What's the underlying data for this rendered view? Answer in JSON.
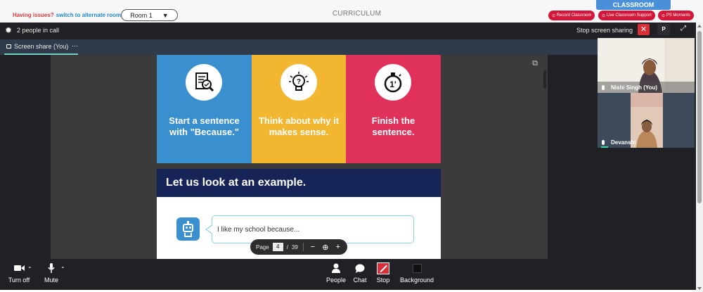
{
  "topbar": {
    "issue_text": "Having issues?",
    "alt_room_link": "switch to alternate room",
    "room_selected": "Room 1",
    "title": "CURRICULUM",
    "classroom_tab": "CLASSROOM",
    "buttons": [
      "Record Classroom",
      "Live Classroom Support",
      "PS Moments"
    ]
  },
  "call": {
    "people_count": "2 people in call",
    "stop_sharing": "Stop screen sharing",
    "p_button": "P",
    "share_label": "Screen share (You)",
    "share_more": "···"
  },
  "slide": {
    "columns": [
      {
        "text": "Start a sentence with \"Because.\"",
        "color": "#3a8fcf"
      },
      {
        "text": "Think about why it makes sense.",
        "color": "#f2b630"
      },
      {
        "text": "Finish the sentence.",
        "color": "#e0315a"
      }
    ],
    "example_title": "Let us look at an example.",
    "bubble_text": "I like my school because..."
  },
  "pager": {
    "label": "Page",
    "current": "4",
    "separator": "/",
    "total": "39"
  },
  "participants": [
    {
      "name": "Nishi Singh (You)"
    },
    {
      "name": "Devanshi"
    }
  ],
  "controls": {
    "camera": "Turn off",
    "mic": "Mute",
    "people": "People",
    "chat": "Chat",
    "stop": "Stop",
    "background": "Background"
  },
  "colors": {
    "accent_red": "#d3173a",
    "share_underline": "#6fd0c2",
    "slide_navy": "#172458"
  }
}
